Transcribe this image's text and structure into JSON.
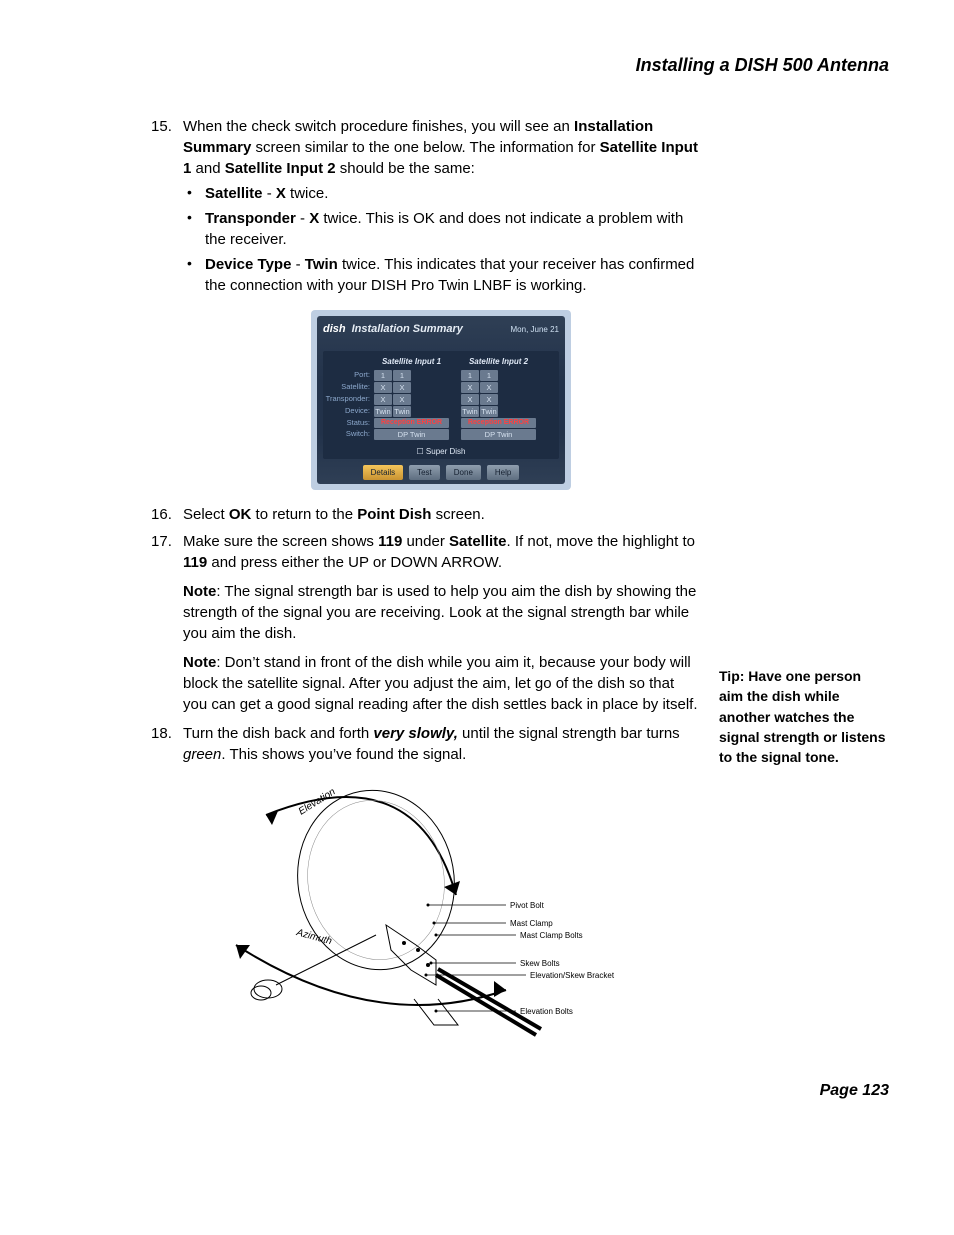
{
  "header": {
    "title": "Installing a DISH 500 Antenna"
  },
  "steps": {
    "s15": {
      "pre1": "When the check switch procedure finishes, you will see an ",
      "b1": "Installation Summary",
      "mid1": " screen similar to the one below. The information for ",
      "b2": "Satellite Input 1",
      "mid2": " and ",
      "b3": "Satellite Input 2",
      "post": " should be the same:",
      "bul1": {
        "b": "Satellite",
        "sep": " - ",
        "b2": "X",
        "rest": " twice."
      },
      "bul2": {
        "b": "Transponder",
        "sep": " - ",
        "b2": "X",
        "rest": " twice. This is OK and does not indicate a problem with the receiver."
      },
      "bul3": {
        "b": "Device Type",
        "sep": " - ",
        "b2": "Twin",
        "rest": " twice. This indicates that your receiver has confirmed the connection with your DISH Pro Twin LNBF is working."
      }
    },
    "s16": {
      "pre": "Select ",
      "b1": "OK",
      "mid": " to return to the ",
      "b2": "Point Dish",
      "post": " screen."
    },
    "s17": {
      "pre": "Make sure the screen shows ",
      "b1": "119",
      "mid1": " under ",
      "b2": "Satellite",
      "mid2": ". If not, move the highlight to ",
      "b3": "119",
      "mid3": " and press either the ",
      "up": "UP",
      "or": " or ",
      "down": "DOWN ARROW",
      "post": ".",
      "note1": {
        "lead": "Note",
        "rest": ": The signal strength bar is used to help you aim the dish by showing the strength of the signal you are receiving. Look at the signal strength bar while you aim the dish."
      },
      "note2": {
        "lead": "Note",
        "rest": ": Don’t stand in front of the dish while you aim it, because your body will block the satellite signal. After you adjust the aim, let go of the dish so that you can get a good signal reading after the dish settles back in place by itself."
      }
    },
    "s18": {
      "pre": "Turn the dish back and forth ",
      "em": "very slowly,",
      "mid": " until the signal strength bar turns ",
      "em2": "green",
      "post": ". This shows you’ve found the signal."
    }
  },
  "sidebar": {
    "tip": "Tip: Have one person aim the dish while another watches the signal strength or listens to the signal tone."
  },
  "screenshot": {
    "logo": "dish",
    "title": "Installation Summary",
    "date": "Mon, June 21",
    "col1": "Satellite Input 1",
    "col2": "Satellite Input 2",
    "rows": {
      "port": "Port:",
      "satellite": "Satellite:",
      "transponder": "Transponder:",
      "device": "Device:",
      "status": "Status:",
      "switch": "Switch:"
    },
    "vals": {
      "one": "1",
      "x": "X",
      "twin": "Twin",
      "err": "Reception ERROR",
      "dp": "DP Twin"
    },
    "check": "Super Dish",
    "buttons": {
      "details": "Details",
      "test": "Test",
      "done": "Done",
      "help": "Help"
    }
  },
  "dish_figure": {
    "elevation": "Elevation",
    "azimuth": "Azimuth",
    "labels": {
      "pivot": "Pivot Bolt",
      "mastclamp": "Mast Clamp",
      "mastbolts": "Mast Clamp Bolts",
      "skew": "Skew Bolts",
      "bracket": "Elevation/Skew Bracket",
      "elevbolts": "Elevation Bolts"
    }
  },
  "footer": {
    "page": "Page 123"
  }
}
